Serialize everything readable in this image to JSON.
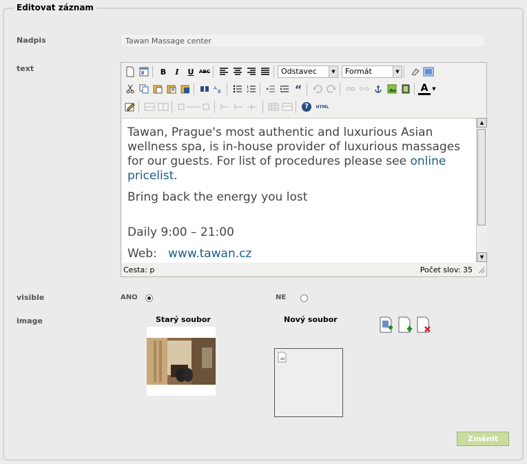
{
  "form": {
    "legend": "Editovat záznam",
    "nadpis_label": "Nadpis",
    "nadpis_value": "Tawan Massage center",
    "text_label": "text",
    "visible_label": "visible",
    "visible_yes": "ANO",
    "visible_no": "NE",
    "visible_selected": "ANO",
    "image_label": "image",
    "old_file_label": "Starý soubor",
    "new_file_label": "Nový soubor",
    "submit_label": "Změnit"
  },
  "editor": {
    "toolbar": {
      "row1_icons": [
        "new-document-icon",
        "templates-icon",
        "bold-icon",
        "italic-icon",
        "underline-icon",
        "strikethrough-icon",
        "align-left-icon",
        "align-center-icon",
        "align-right-icon",
        "align-justify-icon",
        "clear-formatting-icon",
        "fullscreen-icon"
      ],
      "bold": "B",
      "italic": "I",
      "underline": "U",
      "strike": "ABC",
      "block_select": "Odstavec",
      "format_select": "Formát",
      "row2_icons": [
        "cut-icon",
        "copy-icon",
        "paste-icon",
        "paste-text-icon",
        "paste-word-icon",
        "find-icon",
        "replace-icon",
        "bullet-list-icon",
        "numbered-list-icon",
        "outdent-icon",
        "indent-icon",
        "blockquote-icon",
        "undo-icon",
        "redo-icon",
        "link-icon",
        "unlink-icon",
        "anchor-icon",
        "image-icon",
        "media-icon",
        "text-color-icon"
      ],
      "quote": "“",
      "text_color": "A",
      "row3_icons": [
        "edit-html-icon",
        "table-row-icon",
        "table-col-icon",
        "table-insert-icon",
        "table-merge-icon",
        "table-split-icon",
        "table-props-icon",
        "help-icon",
        "html-source-icon"
      ],
      "html": "HTML",
      "help": "?"
    },
    "content": {
      "p1_before": "Tawan, Prague's most authentic and luxurious Asian wellness spa, is in-house provider of luxurious massages for our guests. For list of procedures please see ",
      "p1_link": "online pricelist",
      "p1_after": ".",
      "p2": "Bring back the energy you lost",
      "p3": "Daily 9:00 – 21:00",
      "p4_label": "Web:",
      "p4_link": "www.tawan.cz"
    },
    "status": {
      "path": "Cesta: p",
      "word_count": "Počet slov: 35"
    }
  },
  "colors": {
    "link": "#1a5e8c",
    "submit_bg": "#c8dca0",
    "label": "#555555"
  },
  "icons": {
    "add_file": "add-file-icon",
    "add_new": "add-new-file-icon",
    "delete_file": "delete-file-icon",
    "broken_image": "broken-image-icon"
  }
}
